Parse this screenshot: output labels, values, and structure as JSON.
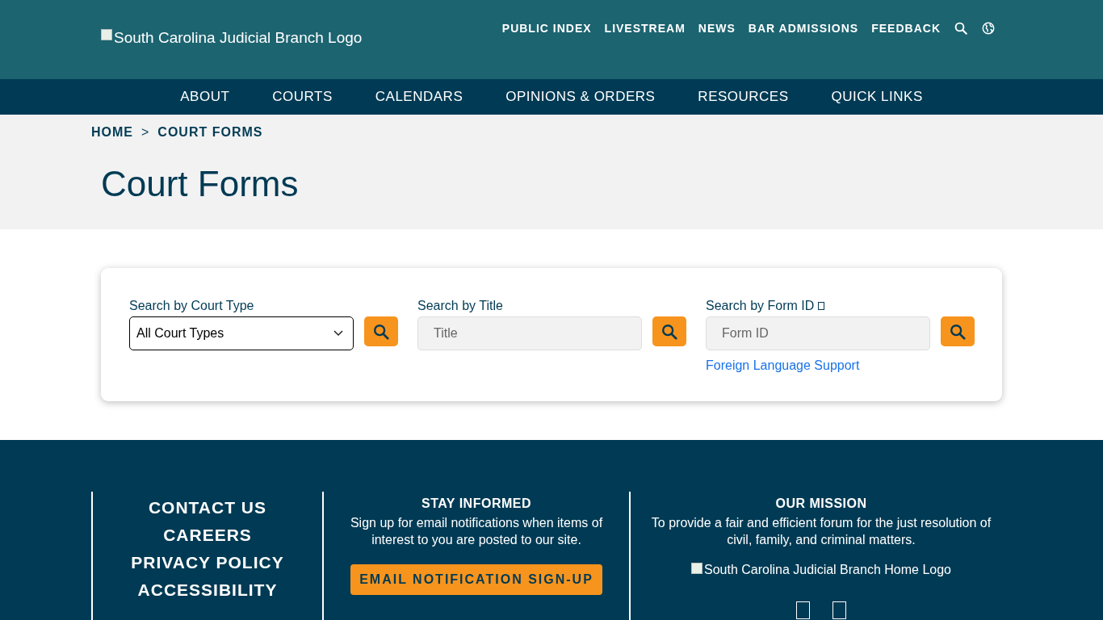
{
  "header": {
    "logo_alt": "South Carolina Judicial Branch Logo",
    "utility_links": [
      "PUBLIC INDEX",
      "LIVESTREAM",
      "NEWS",
      "BAR ADMISSIONS",
      "FEEDBACK"
    ]
  },
  "main_nav": [
    "ABOUT",
    "COURTS",
    "CALENDARS",
    "OPINIONS & ORDERS",
    "RESOURCES",
    "QUICK LINKS"
  ],
  "breadcrumb": {
    "separator": ">",
    "items": [
      "HOME",
      "COURT FORMS"
    ]
  },
  "page_title": "Court Forms",
  "search_fields": [
    {
      "kind": "select",
      "label": "Search by Court Type",
      "value": "All Court Types"
    },
    {
      "kind": "text",
      "label": "Search by Title",
      "placeholder": "Title"
    },
    {
      "kind": "text",
      "label": "Search by Form ID",
      "info_icon": true,
      "placeholder": "Form ID",
      "link": "Foreign Language Support"
    }
  ],
  "footer": {
    "links": [
      "CONTACT US",
      "CAREERS",
      "PRIVACY POLICY",
      "ACCESSIBILITY"
    ],
    "stay_informed": {
      "heading": "STAY INFORMED",
      "text": "Sign up for email notifications when items of interest to you are posted to our site.",
      "button": "EMAIL NOTIFICATION SIGN-UP"
    },
    "mission": {
      "heading": "OUR MISSION",
      "text": "To provide a fair and efficient forum for the just resolution of civil, family, and criminal matters.",
      "logo_alt": "South Carolina Judicial Branch Home Logo"
    }
  }
}
